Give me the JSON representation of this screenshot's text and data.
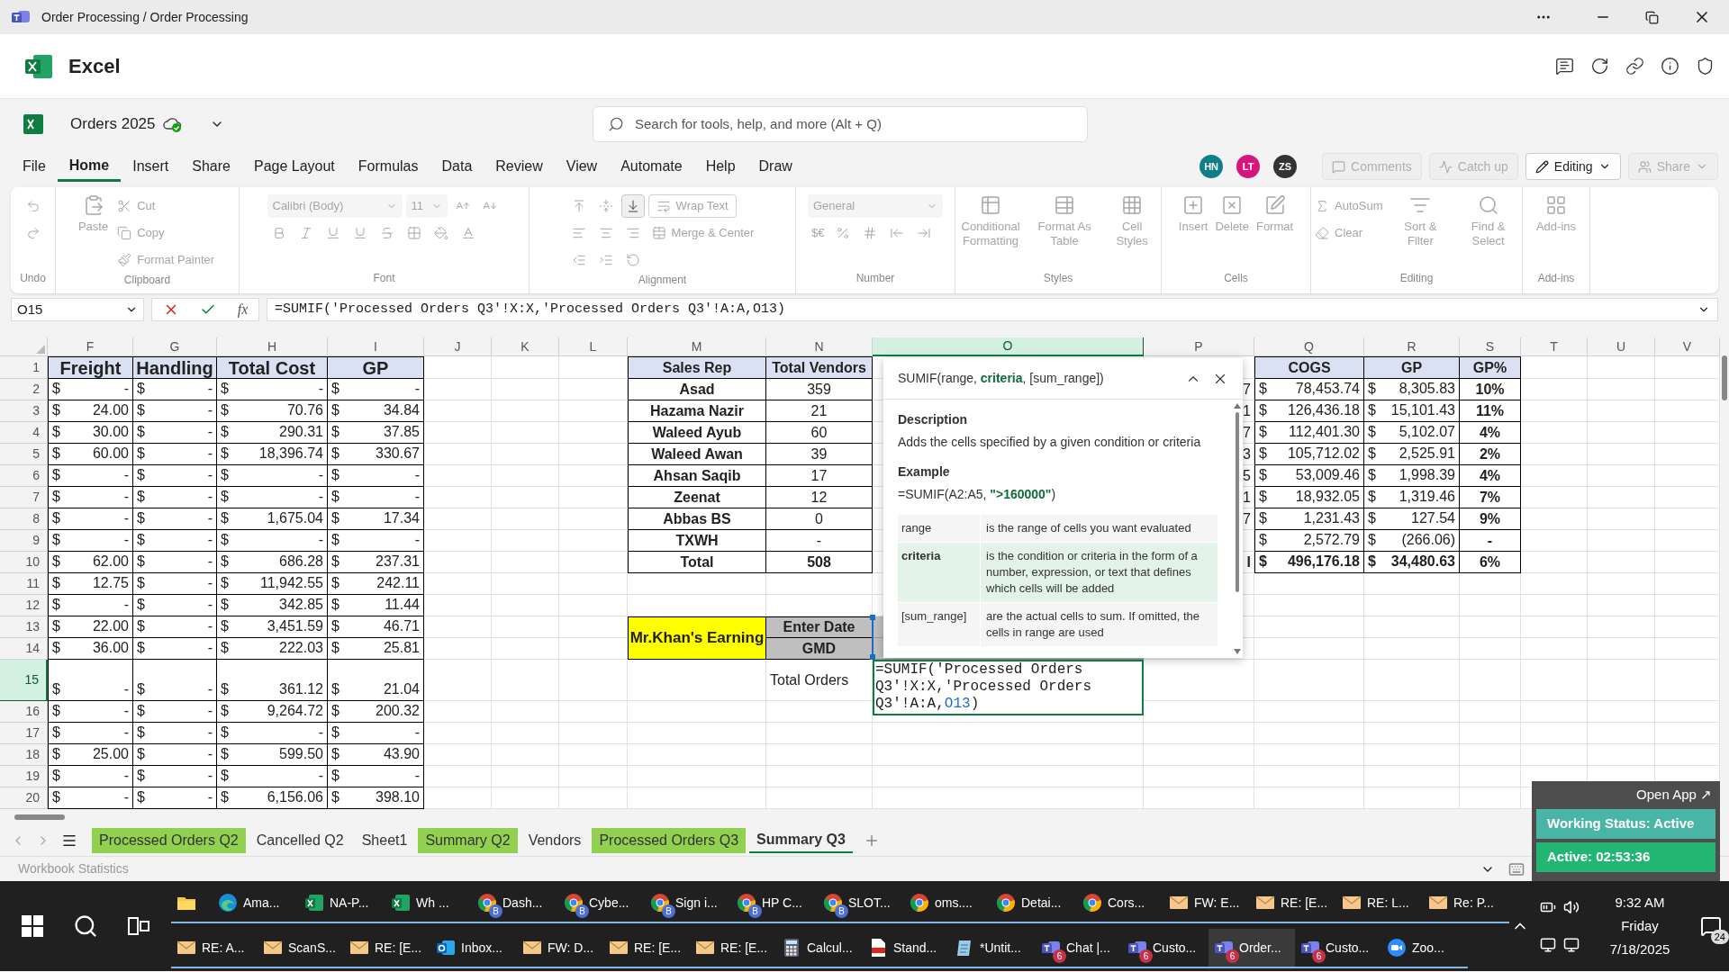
{
  "window": {
    "title": "Order Processing / Order Processing"
  },
  "app": {
    "name": "Excel"
  },
  "document": {
    "name": "Orders 2025"
  },
  "search": {
    "placeholder": "Search for tools, help, and more (Alt + Q)"
  },
  "menu_tabs": [
    {
      "label": "File",
      "selected": false
    },
    {
      "label": "Home",
      "selected": true
    },
    {
      "label": "Insert",
      "selected": false
    },
    {
      "label": "Share",
      "selected": false
    },
    {
      "label": "Page Layout",
      "selected": false
    },
    {
      "label": "Formulas",
      "selected": false
    },
    {
      "label": "Data",
      "selected": false
    },
    {
      "label": "Review",
      "selected": false
    },
    {
      "label": "View",
      "selected": false
    },
    {
      "label": "Automate",
      "selected": false
    },
    {
      "label": "Help",
      "selected": false
    },
    {
      "label": "Draw",
      "selected": false
    }
  ],
  "collaborators": [
    {
      "initials": "HN",
      "color": "#0e7f86"
    },
    {
      "initials": "LT",
      "color": "#d6157f"
    },
    {
      "initials": "ZS",
      "color": "#333333"
    }
  ],
  "header_buttons": [
    {
      "label": "Comments",
      "disabled": true
    },
    {
      "label": "Catch up",
      "disabled": true
    },
    {
      "label": "Editing",
      "disabled": false
    },
    {
      "label": "Share",
      "disabled": true
    }
  ],
  "ribbon": [
    {
      "label": "Undo",
      "columns": [
        [
          [
            {
              "kind": "icon",
              "disabled": true
            }
          ],
          [
            {
              "kind": "icon",
              "disabled": true
            }
          ]
        ]
      ]
    },
    {
      "label": "Clipboard",
      "columns": [
        [
          [
            {
              "kind": "large",
              "label": "Paste",
              "disabled": true
            }
          ]
        ],
        [
          [
            {
              "kind": "small",
              "label": "Cut",
              "disabled": true
            }
          ],
          [
            {
              "kind": "small",
              "label": "Copy",
              "disabled": true
            }
          ],
          [
            {
              "kind": "small",
              "label": "Format Painter",
              "disabled": true
            }
          ]
        ]
      ]
    },
    {
      "label": "Font",
      "columns": [
        [
          [
            {
              "kind": "field",
              "label": "Calibri (Body)",
              "disabled": true
            },
            {
              "kind": "field",
              "label": "11",
              "disabled": true
            },
            {
              "kind": "icon",
              "disabled": true
            },
            {
              "kind": "icon",
              "disabled": true
            }
          ],
          [
            {
              "kind": "icon",
              "disabled": true
            },
            {
              "kind": "icon",
              "disabled": true
            },
            {
              "kind": "icon",
              "disabled": true
            },
            {
              "kind": "icon",
              "disabled": true
            },
            {
              "kind": "icon",
              "disabled": true
            },
            {
              "kind": "icon",
              "disabled": true
            },
            {
              "kind": "icon",
              "disabled": true
            },
            {
              "kind": "icon",
              "disabled": true
            }
          ]
        ]
      ]
    },
    {
      "label": "Alignment",
      "columns": [
        [
          [
            {
              "kind": "icon",
              "disabled": true
            },
            {
              "kind": "icon",
              "disabled": true
            },
            {
              "kind": "icon",
              "disabled": false
            }
          ],
          [
            {
              "kind": "icon",
              "disabled": true
            },
            {
              "kind": "icon",
              "disabled": true
            },
            {
              "kind": "icon",
              "disabled": true
            }
          ],
          [
            {
              "kind": "icon",
              "disabled": true
            },
            {
              "kind": "icon",
              "disabled": true
            },
            {
              "kind": "icon",
              "disabled": true
            }
          ]
        ],
        [
          [
            {
              "kind": "button",
              "label": "Wrap Text",
              "disabled": true
            }
          ],
          [
            {
              "kind": "small",
              "label": "Merge & Center",
              "disabled": true
            }
          ]
        ]
      ]
    },
    {
      "label": "Number",
      "columns": [
        [
          [
            {
              "kind": "field",
              "label": "General",
              "disabled": true
            }
          ],
          [
            {
              "kind": "small",
              "label": "$€",
              "disabled": true
            },
            {
              "kind": "icon",
              "disabled": true
            },
            {
              "kind": "icon",
              "disabled": true
            },
            {
              "kind": "icon",
              "disabled": true
            },
            {
              "kind": "icon",
              "disabled": true
            }
          ]
        ]
      ]
    },
    {
      "label": "Styles",
      "columns": [
        [
          [
            {
              "kind": "large",
              "label": "Conditional Formatting",
              "disabled": true
            }
          ]
        ],
        [
          [
            {
              "kind": "large",
              "label": "Format As Table",
              "disabled": true
            }
          ]
        ],
        [
          [
            {
              "kind": "large",
              "label": "Cell Styles",
              "disabled": true
            }
          ]
        ]
      ]
    },
    {
      "label": "Cells",
      "columns": [
        [
          [
            {
              "kind": "large",
              "label": "Insert",
              "disabled": true
            }
          ]
        ],
        [
          [
            {
              "kind": "large",
              "label": "Delete",
              "disabled": true
            }
          ]
        ],
        [
          [
            {
              "kind": "large",
              "label": "Format",
              "disabled": true
            }
          ]
        ]
      ]
    },
    {
      "label": "Editing",
      "columns": [
        [
          [
            {
              "kind": "small",
              "label": "AutoSum",
              "disabled": true
            }
          ],
          [
            {
              "kind": "small",
              "label": "Clear",
              "disabled": true
            }
          ]
        ],
        [
          [
            {
              "kind": "large",
              "label": "Sort & Filter",
              "disabled": true
            }
          ]
        ],
        [
          [
            {
              "kind": "large",
              "label": "Find & Select",
              "disabled": true
            }
          ]
        ]
      ]
    },
    {
      "label": "Add-ins",
      "columns": [
        [
          [
            {
              "kind": "large",
              "label": "Add-ins",
              "disabled": true
            }
          ]
        ]
      ]
    }
  ],
  "formula_bar": {
    "name_box": "O15",
    "function_label": "fx",
    "formula": "=SUMIF('Processed Orders Q3'!X:X,'Processed Orders Q3'!A:A,O13)"
  },
  "columns": [
    {
      "letter": "F",
      "selected": false
    },
    {
      "letter": "G",
      "selected": false
    },
    {
      "letter": "H",
      "selected": false
    },
    {
      "letter": "I",
      "selected": false
    },
    {
      "letter": "J",
      "selected": false
    },
    {
      "letter": "K",
      "selected": false
    },
    {
      "letter": "L",
      "selected": false
    },
    {
      "letter": "M",
      "selected": false
    },
    {
      "letter": "N",
      "selected": false
    },
    {
      "letter": "O",
      "selected": true
    },
    {
      "letter": "P",
      "selected": false
    },
    {
      "letter": "Q",
      "selected": false
    },
    {
      "letter": "R",
      "selected": false
    },
    {
      "letter": "S",
      "selected": false
    },
    {
      "letter": "T",
      "selected": false
    },
    {
      "letter": "U",
      "selected": false
    },
    {
      "letter": "V",
      "selected": false
    }
  ],
  "rows": [
    {
      "number": "1",
      "selected": false
    },
    {
      "number": "2",
      "selected": false
    },
    {
      "number": "3",
      "selected": false
    },
    {
      "number": "4",
      "selected": false
    },
    {
      "number": "5",
      "selected": false
    },
    {
      "number": "6",
      "selected": false
    },
    {
      "number": "7",
      "selected": false
    },
    {
      "number": "8",
      "selected": false
    },
    {
      "number": "9",
      "selected": false
    },
    {
      "number": "10",
      "selected": false
    },
    {
      "number": "11",
      "selected": false
    },
    {
      "number": "12",
      "selected": false
    },
    {
      "number": "13",
      "selected": false
    },
    {
      "number": "14",
      "selected": false
    },
    {
      "number": "15",
      "selected": true
    },
    {
      "number": "16",
      "selected": false
    },
    {
      "number": "17",
      "selected": false
    },
    {
      "number": "18",
      "selected": false
    },
    {
      "number": "19",
      "selected": false
    },
    {
      "number": "20",
      "selected": false
    }
  ],
  "cost_table": {
    "headers": [
      "Freight",
      "Handling",
      "Total Cost",
      "GP"
    ],
    "rows": [
      [
        [
          "$",
          "-"
        ],
        [
          "$",
          "-"
        ],
        [
          "$",
          "-"
        ],
        [
          "$",
          "-"
        ]
      ],
      [
        [
          "$",
          "24.00"
        ],
        [
          "$",
          "-"
        ],
        [
          "$",
          "70.76"
        ],
        [
          "$",
          "34.84"
        ]
      ],
      [
        [
          "$",
          "30.00"
        ],
        [
          "$",
          "-"
        ],
        [
          "$",
          "290.31"
        ],
        [
          "$",
          "37.85"
        ]
      ],
      [
        [
          "$",
          "60.00"
        ],
        [
          "$",
          "-"
        ],
        [
          "$",
          "18,396.74"
        ],
        [
          "$",
          "330.67"
        ]
      ],
      [
        [
          "$",
          "-"
        ],
        [
          "$",
          "-"
        ],
        [
          "$",
          "-"
        ],
        [
          "$",
          "-"
        ]
      ],
      [
        [
          "$",
          "-"
        ],
        [
          "$",
          "-"
        ],
        [
          "$",
          "-"
        ],
        [
          "$",
          "-"
        ]
      ],
      [
        [
          "$",
          "-"
        ],
        [
          "$",
          "-"
        ],
        [
          "$",
          "1,675.04"
        ],
        [
          "$",
          "17.34"
        ]
      ],
      [
        [
          "$",
          "-"
        ],
        [
          "$",
          "-"
        ],
        [
          "$",
          "-"
        ],
        [
          "$",
          "-"
        ]
      ],
      [
        [
          "$",
          "62.00"
        ],
        [
          "$",
          "-"
        ],
        [
          "$",
          "686.28"
        ],
        [
          "$",
          "237.31"
        ]
      ],
      [
        [
          "$",
          "12.75"
        ],
        [
          "$",
          "-"
        ],
        [
          "$",
          "11,942.55"
        ],
        [
          "$",
          "242.11"
        ]
      ],
      [
        [
          "$",
          "-"
        ],
        [
          "$",
          "-"
        ],
        [
          "$",
          "342.85"
        ],
        [
          "$",
          "11.44"
        ]
      ],
      [
        [
          "$",
          "22.00"
        ],
        [
          "$",
          "-"
        ],
        [
          "$",
          "3,451.59"
        ],
        [
          "$",
          "46.71"
        ]
      ],
      [
        [
          "$",
          "36.00"
        ],
        [
          "$",
          "-"
        ],
        [
          "$",
          "222.03"
        ],
        [
          "$",
          "25.81"
        ]
      ],
      [
        [
          "$",
          "-"
        ],
        [
          "$",
          "-"
        ],
        [
          "$",
          "361.12"
        ],
        [
          "$",
          "21.04"
        ]
      ],
      [
        [
          "$",
          "-"
        ],
        [
          "$",
          "-"
        ],
        [
          "$",
          "9,264.72"
        ],
        [
          "$",
          "200.32"
        ]
      ],
      [
        [
          "$",
          "-"
        ],
        [
          "$",
          "-"
        ],
        [
          "$",
          "-"
        ],
        [
          "$",
          "-"
        ]
      ],
      [
        [
          "$",
          "25.00"
        ],
        [
          "$",
          "-"
        ],
        [
          "$",
          "599.50"
        ],
        [
          "$",
          "43.90"
        ]
      ],
      [
        [
          "$",
          "-"
        ],
        [
          "$",
          "-"
        ],
        [
          "$",
          "-"
        ],
        [
          "$",
          "-"
        ]
      ],
      [
        [
          "$",
          "-"
        ],
        [
          "$",
          "-"
        ],
        [
          "$",
          "6,156.06"
        ],
        [
          "$",
          "398.10"
        ]
      ]
    ]
  },
  "sales_table": {
    "headers": [
      "Sales Rep",
      "Total Vendors",
      "COGS",
      "GP",
      "GP%"
    ],
    "rows": [
      {
        "kind": "rep",
        "rep": "Asad",
        "vendors": "359",
        "column_p": "7",
        "cogs": [
          "$",
          "78,453.74"
        ],
        "gp": [
          "$",
          "8,305.83"
        ],
        "gp_pct": "10%"
      },
      {
        "kind": "rep",
        "rep": "Hazama Nazir",
        "vendors": "21",
        "column_p": "1",
        "cogs": [
          "$",
          "126,436.18"
        ],
        "gp": [
          "$",
          "15,101.43"
        ],
        "gp_pct": "11%"
      },
      {
        "kind": "rep",
        "rep": "Waleed Ayub",
        "vendors": "60",
        "column_p": "7",
        "cogs": [
          "$",
          "112,401.30"
        ],
        "gp": [
          "$",
          "5,102.07"
        ],
        "gp_pct": "4%"
      },
      {
        "kind": "rep",
        "rep": "Waleed Awan",
        "vendors": "39",
        "column_p": "3",
        "cogs": [
          "$",
          "105,712.02"
        ],
        "gp": [
          "$",
          "2,525.91"
        ],
        "gp_pct": "2%"
      },
      {
        "kind": "rep",
        "rep": "Ahsan Saqib",
        "vendors": "17",
        "column_p": "5",
        "cogs": [
          "$",
          "53,009.46"
        ],
        "gp": [
          "$",
          "1,998.39"
        ],
        "gp_pct": "4%"
      },
      {
        "kind": "rep",
        "rep": "Zeenat",
        "vendors": "12",
        "column_p": "1",
        "cogs": [
          "$",
          "18,932.05"
        ],
        "gp": [
          "$",
          "1,319.46"
        ],
        "gp_pct": "7%"
      },
      {
        "kind": "rep",
        "rep": "Abbas BS",
        "vendors": "0",
        "column_p": "7",
        "cogs": [
          "$",
          "1,231.43"
        ],
        "gp": [
          "$",
          "127.54"
        ],
        "gp_pct": "9%"
      },
      {
        "kind": "rep",
        "rep": "TXWH",
        "vendors": "-",
        "cogs": [
          "$",
          "2,572.79"
        ],
        "gp": [
          "$",
          "(266.06)"
        ],
        "gp_pct": "-"
      },
      {
        "kind": "total",
        "rep": "Total",
        "vendors": "508",
        "column_p": "l",
        "cogs": [
          "$",
          "496,176.18"
        ],
        "gp": [
          "$",
          "34,480.63"
        ],
        "gp_pct": "6%"
      }
    ]
  },
  "earning_box": {
    "title": "Mr.Khan's Earning",
    "fields": [
      "Enter Date",
      "GMD"
    ],
    "total_label": "Total Orders"
  },
  "function_tooltip": {
    "signature": "SUMIF(range, **criteria**, [sum_range])",
    "description_heading": "Description",
    "description": "Adds the cells specified by a given condition or criteria",
    "example_heading": "Example",
    "example": "=SUMIF(A2:A5, **\">160000\"**)",
    "arguments": [
      {
        "name": "range",
        "description": "is the range of cells you want evaluated",
        "selected": false
      },
      {
        "name": "criteria",
        "description": "is the condition or criteria in the form of a number, expression, or text that defines which cells will be added",
        "selected": true
      },
      {
        "name": "[sum_range]",
        "description": "are the actual cells to sum. If omitted, the cells in range are used",
        "selected": false
      }
    ]
  },
  "cell_editor": {
    "text": "=SUMIF('Processed Orders Q3'!X:X,'Processed Orders Q3'!A:A,",
    "reference": "O13",
    "suffix": ")"
  },
  "sheet_tabs": [
    {
      "label": "Processed Orders Q2",
      "selected": false,
      "color": "#92d050"
    },
    {
      "label": "Cancelled Q2",
      "selected": false
    },
    {
      "label": "Sheet1",
      "selected": false
    },
    {
      "label": "Summary Q2",
      "selected": false,
      "color": "#92d050"
    },
    {
      "label": "Vendors",
      "selected": false
    },
    {
      "label": "Processed Orders Q3",
      "selected": false,
      "color": "#92d050"
    },
    {
      "label": "Summary Q3",
      "selected": true
    }
  ],
  "status_bar": {
    "text": "Workbook Statistics"
  },
  "status_widget": {
    "open_app": "Open App ↗",
    "status": "Working Status: Active",
    "timer": "Active: 02:53:36"
  },
  "taskbar": {
    "rows": [
      [
        {
          "kind": "explorer",
          "selected": false
        },
        {
          "kind": "edge",
          "label": "Ama...",
          "selected": false
        },
        {
          "kind": "excel",
          "label": "NA-P...",
          "selected": false
        },
        {
          "kind": "excel",
          "label": "Wh ...",
          "selected": false
        },
        {
          "kind": "chrome",
          "label": "Dash...",
          "badge": "B",
          "selected": false
        },
        {
          "kind": "chrome",
          "label": "Cybe...",
          "badge": "B",
          "selected": false
        },
        {
          "kind": "chrome",
          "label": "Sign i...",
          "badge": "B",
          "selected": false
        },
        {
          "kind": "chrome",
          "label": "HP C...",
          "badge": "B",
          "selected": false
        },
        {
          "kind": "chrome",
          "label": "SLOT...",
          "badge": "B",
          "selected": false
        },
        {
          "kind": "chrome",
          "label": "oms....",
          "selected": false
        },
        {
          "kind": "chrome",
          "label": "Detai...",
          "selected": false
        },
        {
          "kind": "chrome",
          "label": "Cors...",
          "selected": false
        },
        {
          "kind": "mail",
          "label": "FW: E...",
          "selected": false
        },
        {
          "kind": "mail",
          "label": "RE: [E...",
          "selected": false
        },
        {
          "kind": "mail",
          "label": "RE: L...",
          "selected": false
        },
        {
          "kind": "mail",
          "label": "Re: P...",
          "selected": false
        }
      ],
      [
        {
          "kind": "mail",
          "label": "RE: A...",
          "selected": false
        },
        {
          "kind": "mail",
          "label": "ScanS...",
          "selected": false
        },
        {
          "kind": "mail",
          "label": "RE: [E...",
          "selected": false
        },
        {
          "kind": "outlook",
          "label": "Inbox...",
          "selected": false
        },
        {
          "kind": "mail",
          "label": "FW: D...",
          "selected": false
        },
        {
          "kind": "mail",
          "label": "RE: [E...",
          "selected": false
        },
        {
          "kind": "mail",
          "label": "RE: [E...",
          "selected": false
        },
        {
          "kind": "calculator",
          "label": "Calcul...",
          "selected": false
        },
        {
          "kind": "pdf",
          "label": "Stand...",
          "selected": false
        },
        {
          "kind": "notepad",
          "label": "*Untit...",
          "selected": false
        },
        {
          "kind": "teams",
          "label": "Chat |...",
          "badge": "6",
          "selected": false
        },
        {
          "kind": "teams",
          "label": "Custo...",
          "badge": "6",
          "selected": false
        },
        {
          "kind": "teams",
          "label": "Order...",
          "badge": "6",
          "selected": true
        },
        {
          "kind": "teams",
          "label": "Custo...",
          "badge": "6",
          "selected": false
        },
        {
          "kind": "zoom",
          "label": "Zoo...",
          "selected": false
        }
      ]
    ],
    "clock": {
      "time": "9:32 AM",
      "day": "Friday",
      "date": "7/18/2025"
    },
    "notifications": "24"
  }
}
